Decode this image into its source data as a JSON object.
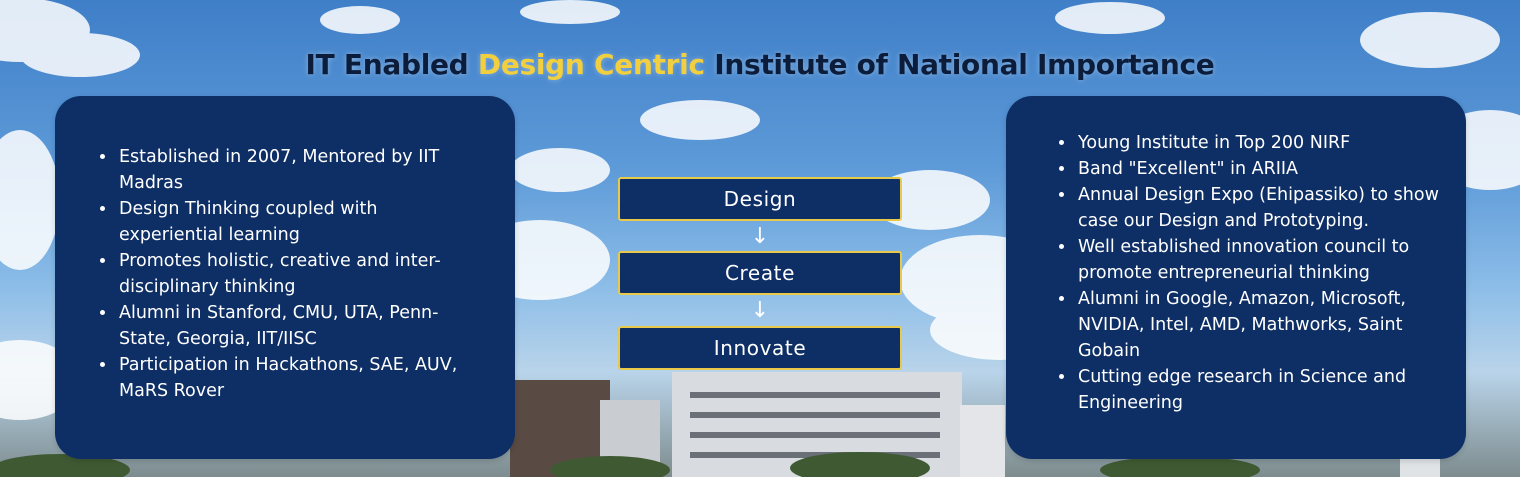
{
  "header": {
    "title_prefix": "IT Enabled",
    "title_highlight": "Design Centric",
    "title_suffix": "Institute of National Importance"
  },
  "colors": {
    "panel_bg": "#0e2f66",
    "highlight": "#f1cf3f",
    "step_border": "#e8c94a",
    "title": "#0b1d3a"
  },
  "left_panel": {
    "items": [
      "Established in 2007, Mentored by IIT Madras",
      "Design Thinking coupled with experiential learning",
      "Promotes holistic, creative and inter-disciplinary thinking",
      "Alumni in Stanford, CMU, UTA, Penn-State, Georgia, IIT/IISC",
      "Participation in Hackathons, SAE, AUV, MaRS Rover"
    ]
  },
  "flow": {
    "steps": [
      "Design",
      "Create",
      "Innovate"
    ],
    "arrow": "↓"
  },
  "right_panel": {
    "items": [
      "Young Institute in Top 200 NIRF",
      "Band \"Excellent\" in ARIIA",
      "Annual Design Expo (Ehipassiko) to show case our Design and Prototyping.",
      "Well established innovation council to promote entrepreneurial thinking",
      "Alumni in Google, Amazon, Microsoft, NVIDIA, Intel, AMD, Mathworks, Saint Gobain",
      "Cutting edge research in Science and Engineering"
    ]
  }
}
